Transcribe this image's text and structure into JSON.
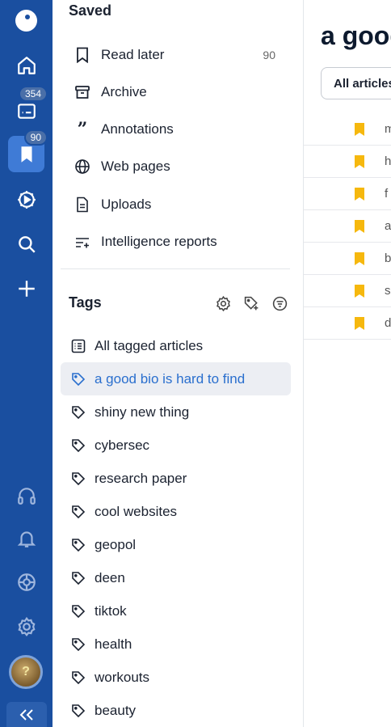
{
  "rail": {
    "inbox_badge": "354",
    "saved_badge": "90"
  },
  "saved": {
    "title": "Saved",
    "items": [
      {
        "label": "Read later",
        "count": "90",
        "icon": "bookmark-icon"
      },
      {
        "label": "Archive",
        "icon": "archive-icon"
      },
      {
        "label": "Annotations",
        "icon": "quote-icon"
      },
      {
        "label": "Web pages",
        "icon": "globe-icon"
      },
      {
        "label": "Uploads",
        "icon": "document-icon"
      },
      {
        "label": "Intelligence reports",
        "icon": "sparkle-list-icon"
      }
    ]
  },
  "tags": {
    "title": "Tags",
    "all_label": "All tagged articles",
    "items": [
      "a good bio is hard to find",
      "shiny new thing",
      "cybersec",
      "research paper",
      "cool websites",
      "geopol",
      "deen",
      "tiktok",
      "health",
      "workouts",
      "beauty"
    ]
  },
  "content": {
    "title": "a good bio is hard to find",
    "filter_label": "All articles",
    "rows": [
      "m",
      "h",
      "f",
      "a",
      "b",
      "s",
      "d"
    ]
  },
  "colors": {
    "rail": "#1a4fa0",
    "selected_tag_text": "#2a6fce",
    "bookmark": "#f6b80e"
  }
}
